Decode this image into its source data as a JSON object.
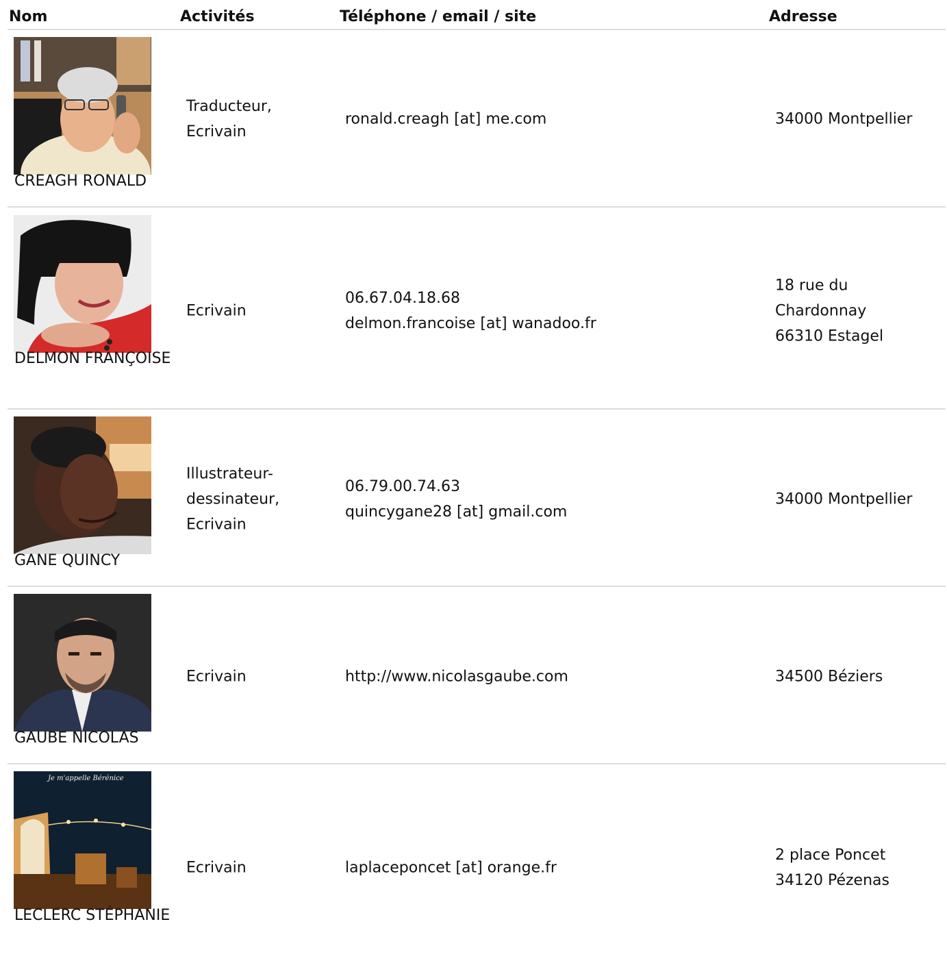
{
  "header": {
    "col_name": "Nom",
    "col_activities": "Activités",
    "col_contact": "Téléphone / email / site",
    "col_address": "Adresse"
  },
  "rows": [
    {
      "name": "CREAGH RONALD",
      "activities": [
        "Traducteur,",
        "Ecrivain"
      ],
      "contact": [
        "ronald.creagh [at] me.com"
      ],
      "address": [
        "34000 Montpellier"
      ]
    },
    {
      "name": "DELMON FRANÇOISE",
      "activities": [
        "Ecrivain"
      ],
      "contact": [
        "06.67.04.18.68",
        "delmon.francoise [at] wanadoo.fr"
      ],
      "address": [
        "18 rue du",
        "Chardonnay",
        "66310 Estagel"
      ]
    },
    {
      "name": "GANE QUINCY",
      "activities": [
        "Illustrateur-",
        "dessinateur,",
        "Ecrivain"
      ],
      "contact": [
        "06.79.00.74.63",
        "quincygane28 [at] gmail.com"
      ],
      "address": [
        "34000 Montpellier"
      ]
    },
    {
      "name": "GAUBE NICOLAS",
      "activities": [
        "Ecrivain"
      ],
      "contact": [
        "http://www.nicolasgaube.com"
      ],
      "address": [
        "34500 Béziers"
      ]
    },
    {
      "name": "LECLERC STÉPHANIE",
      "activities": [
        "Ecrivain"
      ],
      "contact": [
        "laplaceponcet [at] orange.fr"
      ],
      "address": [
        "2 place Poncet",
        "34120 Pézenas"
      ],
      "photo_caption": "Je m'appelle Bérénice"
    }
  ]
}
